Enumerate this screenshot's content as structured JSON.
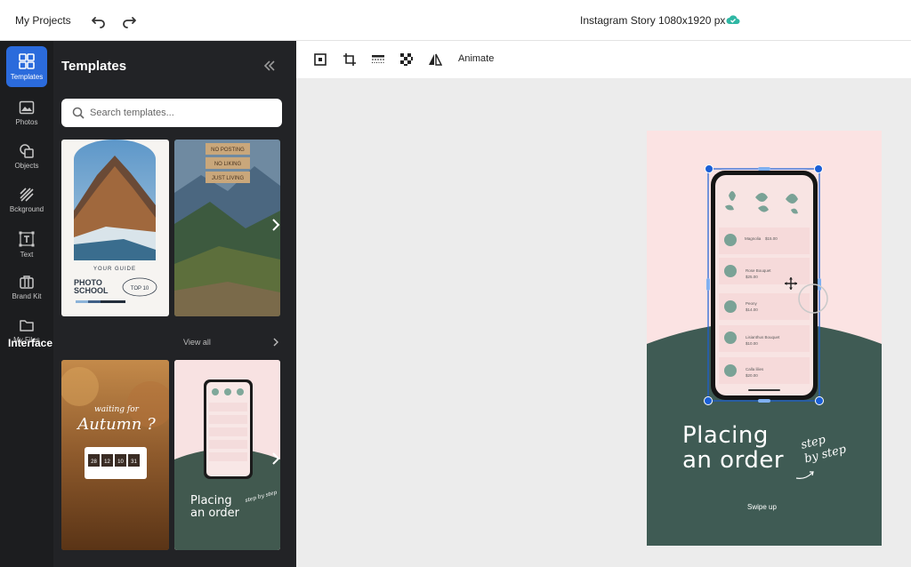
{
  "topbar": {
    "my_projects": "My Projects",
    "doc_title": "Instagram Story 1080x1920 px"
  },
  "rail": {
    "items": [
      {
        "label": "Templates",
        "icon": "templates-icon"
      },
      {
        "label": "Photos",
        "icon": "photos-icon"
      },
      {
        "label": "Objects",
        "icon": "objects-icon"
      },
      {
        "label": "Bckground",
        "icon": "background-icon"
      },
      {
        "label": "Text",
        "icon": "text-icon"
      },
      {
        "label": "Brand Kit",
        "icon": "brand-kit-icon"
      },
      {
        "label": "My Files",
        "icon": "my-files-icon"
      }
    ]
  },
  "panel": {
    "title": "Templates",
    "search_placeholder": "Search templates...",
    "section_interface": "Interface",
    "view_all": "View all"
  },
  "templates": {
    "photo_school": {
      "guide": "YOUR GUIDE",
      "line1": "PHOTO",
      "line2": "SCHOOL",
      "badge": "TOP 10"
    },
    "mountain_signs": [
      "NO POSTING",
      "NO LIKING",
      "JUST LIVING"
    ],
    "autumn": {
      "script1": "waiting for",
      "script2": "Autumn ?",
      "counter": [
        "28",
        "12",
        "10",
        "31"
      ]
    },
    "placing_small": {
      "line1": "Placing",
      "line2": "an order",
      "script": "step by step"
    }
  },
  "toolbar": {
    "animate": "Animate"
  },
  "artboard": {
    "line1": "Placing",
    "line2": "an order",
    "script_line1": "step",
    "script_line2": "by step",
    "swipe": "Swipe up",
    "rows": [
      {
        "name": "Magnolia",
        "price": "$15.00"
      },
      {
        "name": "Rose Bouquet",
        "price": "$25.00"
      },
      {
        "name": "Peony",
        "price": "$14.00"
      },
      {
        "name": "Lisianthus Bouquet",
        "price": "$10.00"
      },
      {
        "name": "Calla lilies",
        "price": "$20.00"
      }
    ]
  },
  "colors": {
    "accent": "#2b6bdc",
    "artboard_pink": "#fbe3e3",
    "artboard_green": "#3f5b54",
    "panel_bg": "#222326",
    "rail_bg": "#1c1d1f"
  }
}
